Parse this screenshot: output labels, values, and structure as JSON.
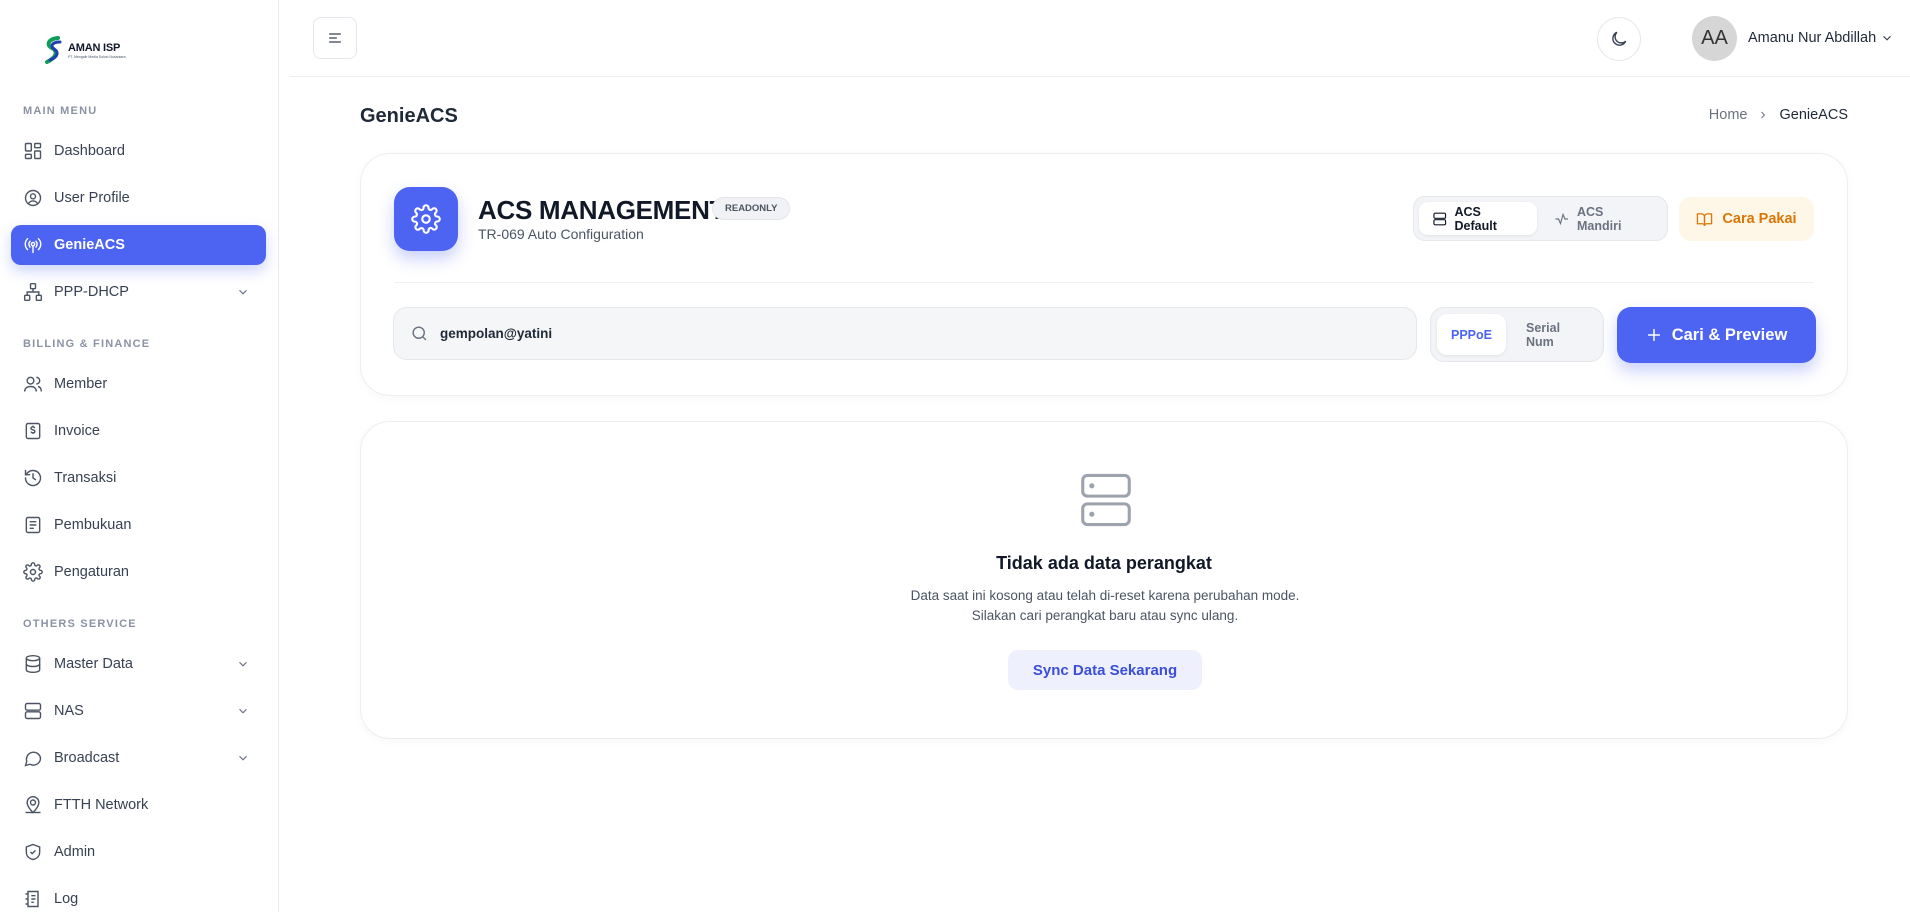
{
  "brand": {
    "name": "AMAN ISP",
    "tagline": "PT. Mengalir Media Solusi Nusantara"
  },
  "sidebar": {
    "sections": [
      "MAIN MENU",
      "BILLING & FINANCE",
      "OTHERS SERVICE"
    ],
    "items": [
      {
        "label": "Dashboard",
        "icon": "dashboard-icon"
      },
      {
        "label": "User Profile",
        "icon": "user-circle-icon"
      },
      {
        "label": "GenieACS",
        "icon": "broadcast-icon",
        "active": true
      },
      {
        "label": "PPP-DHCP",
        "icon": "network-icon",
        "expandable": true
      },
      {
        "label": "Member",
        "icon": "users-icon"
      },
      {
        "label": "Invoice",
        "icon": "invoice-icon"
      },
      {
        "label": "Transaksi",
        "icon": "history-icon"
      },
      {
        "label": "Pembukuan",
        "icon": "ledger-icon"
      },
      {
        "label": "Pengaturan",
        "icon": "gear-icon"
      },
      {
        "label": "Master Data",
        "icon": "database-icon",
        "expandable": true
      },
      {
        "label": "NAS",
        "icon": "server-icon",
        "expandable": true
      },
      {
        "label": "Broadcast",
        "icon": "chat-icon",
        "expandable": true
      },
      {
        "label": "FTTH Network",
        "icon": "map-pin-user-icon"
      },
      {
        "label": "Admin",
        "icon": "shield-check-icon"
      },
      {
        "label": "Log",
        "icon": "log-icon"
      }
    ]
  },
  "topbar": {
    "avatar_initials": "AA",
    "user_name": "Amanu Nur Abdillah"
  },
  "page": {
    "title": "GenieACS",
    "breadcrumb": [
      "Home",
      "GenieACS"
    ]
  },
  "acs": {
    "title": "ACS MANAGEMENT",
    "badge": "READONLY",
    "subtitle": "TR-069 Auto Configuration",
    "modes": [
      "ACS Default",
      "ACS Mandiri"
    ],
    "active_mode": "ACS Default",
    "help_label": "Cara Pakai"
  },
  "search": {
    "value": "gempolan@yatini",
    "types": [
      "PPPoE",
      "Serial Num"
    ],
    "active_type": "PPPoE",
    "button_label": "Cari & Preview"
  },
  "empty_state": {
    "title": "Tidak ada data perangkat",
    "description": "Data saat ini kosong atau telah di-reset karena perubahan mode. Silakan cari perangkat baru atau sync ulang.",
    "button_label": "Sync Data Sekarang"
  },
  "colors": {
    "primary": "#4d63f2",
    "help_text": "#d97706",
    "help_bg": "#fef6e7"
  }
}
